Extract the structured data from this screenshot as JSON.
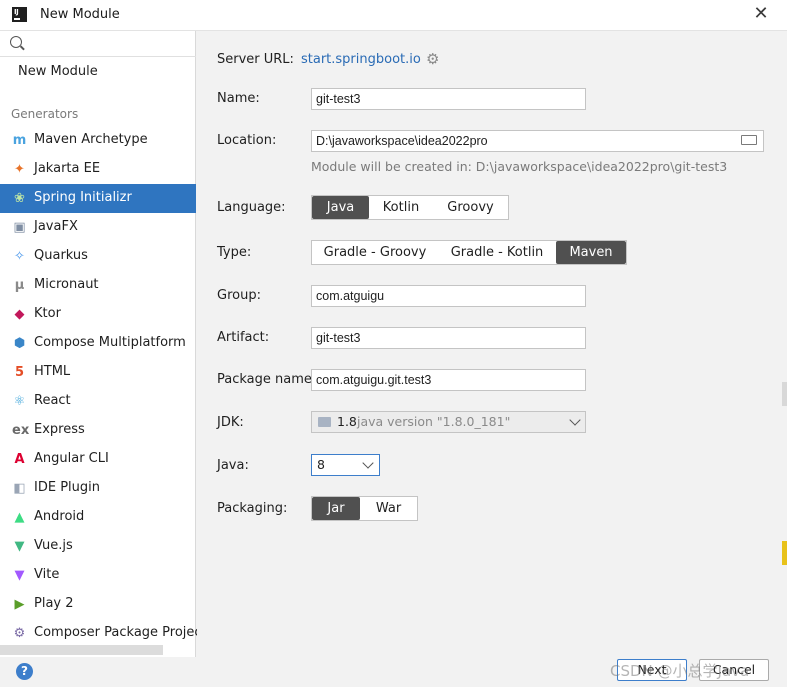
{
  "window": {
    "title": "New Module",
    "app_icon": "intellij-icon",
    "close": "✕"
  },
  "search": {
    "placeholder": ""
  },
  "left": {
    "new_module": "New Module",
    "generators_header": "Generators",
    "items": [
      {
        "label": "Maven Archetype",
        "icon": "maven-icon",
        "glyph": "m",
        "color": "#4aa3df"
      },
      {
        "label": "Jakarta EE",
        "icon": "jakarta-icon",
        "glyph": "✦",
        "color": "#e8742a"
      },
      {
        "label": "Spring Initializr",
        "icon": "spring-icon",
        "glyph": "❀",
        "color": "#6db33f",
        "selected": true
      },
      {
        "label": "JavaFX",
        "icon": "javafx-icon",
        "glyph": "▣",
        "color": "#7f8ea3"
      },
      {
        "label": "Quarkus",
        "icon": "quarkus-icon",
        "glyph": "✧",
        "color": "#4695eb"
      },
      {
        "label": "Micronaut",
        "icon": "micronaut-icon",
        "glyph": "μ",
        "color": "#8a8a8a"
      },
      {
        "label": "Ktor",
        "icon": "ktor-icon",
        "glyph": "◆",
        "color": "#c2185b"
      },
      {
        "label": "Compose Multiplatform",
        "icon": "compose-icon",
        "glyph": "⬢",
        "color": "#3a86c8"
      },
      {
        "label": "HTML",
        "icon": "html5-icon",
        "glyph": "5",
        "color": "#e44d26"
      },
      {
        "label": "React",
        "icon": "react-icon",
        "glyph": "⚛",
        "color": "#3aa3d9"
      },
      {
        "label": "Express",
        "icon": "express-icon",
        "glyph": "ex",
        "color": "#6a6a6a"
      },
      {
        "label": "Angular CLI",
        "icon": "angular-icon",
        "glyph": "A",
        "color": "#dd0031"
      },
      {
        "label": "IDE Plugin",
        "icon": "plugin-icon",
        "glyph": "◧",
        "color": "#9aa5b5"
      },
      {
        "label": "Android",
        "icon": "android-icon",
        "glyph": "▲",
        "color": "#3ddc84"
      },
      {
        "label": "Vue.js",
        "icon": "vue-icon",
        "glyph": "▼",
        "color": "#41b883"
      },
      {
        "label": "Vite",
        "icon": "vite-icon",
        "glyph": "▼",
        "color": "#a259ff"
      },
      {
        "label": "Play 2",
        "icon": "play-icon",
        "glyph": "▶",
        "color": "#5a9e2a"
      },
      {
        "label": "Composer Package Project",
        "icon": "composer-icon",
        "glyph": "⚙",
        "color": "#7a6aa5"
      }
    ]
  },
  "form": {
    "server_url_label": "Server URL:",
    "server_url": "start.springboot.io",
    "name_label": "Name:",
    "name": "git-test3",
    "location_label": "Location:",
    "location": "D:\\javaworkspace\\idea2022pro",
    "location_hint": "Module will be created in: D:\\javaworkspace\\idea2022pro\\git-test3",
    "language_label": "Language:",
    "languages": [
      "Java",
      "Kotlin",
      "Groovy"
    ],
    "language_selected": "Java",
    "type_label": "Type:",
    "types": [
      "Gradle - Groovy",
      "Gradle - Kotlin",
      "Maven"
    ],
    "type_selected": "Maven",
    "group_label": "Group:",
    "group": "com.atguigu",
    "artifact_label": "Artifact:",
    "artifact": "git-test3",
    "package_label": "Package name:",
    "package": "com.atguigu.git.test3",
    "jdk_label": "JDK:",
    "jdk_version": "1.8",
    "jdk_desc": "java version \"1.8.0_181\"",
    "java_label": "Java:",
    "java_version": "8",
    "packaging_label": "Packaging:",
    "packagings": [
      "Jar",
      "War"
    ],
    "packaging_selected": "Jar"
  },
  "bottom": {
    "help": "?",
    "next": "Next",
    "cancel": "Cancel",
    "watermark": "CSDN @小总学Java"
  }
}
